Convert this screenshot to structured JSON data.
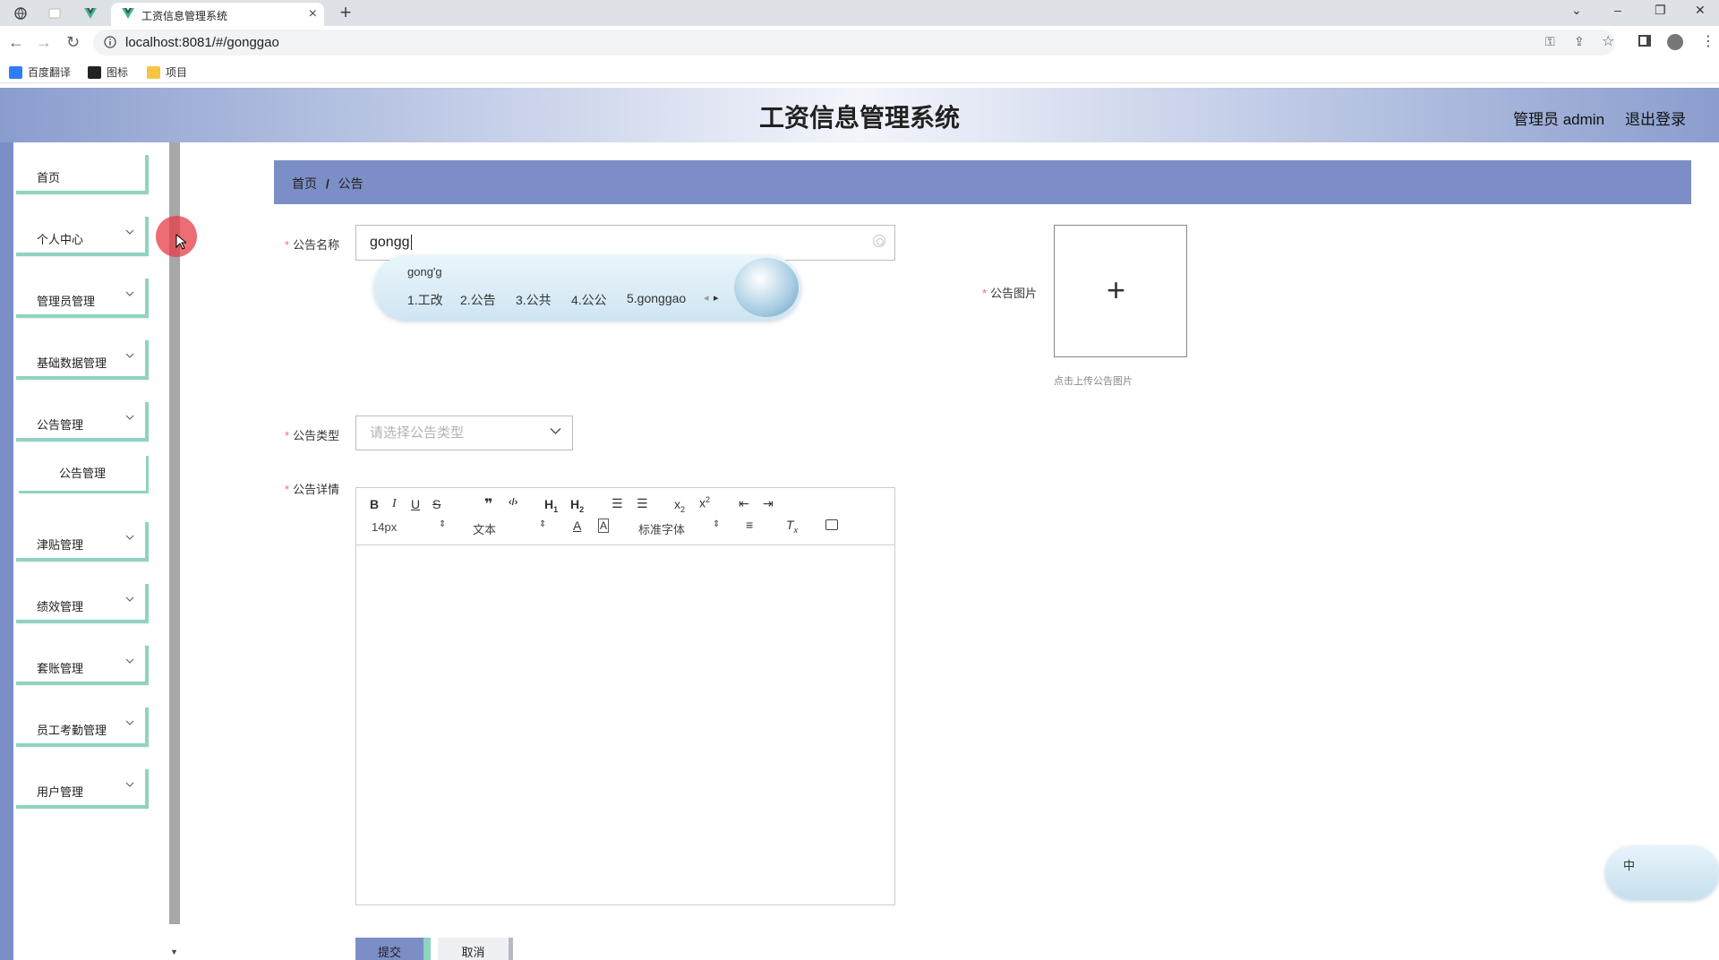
{
  "browser": {
    "tab_title": "工资信息管理系统",
    "url": "localhost:8081/#/gonggao",
    "bookmarks": [
      {
        "label": "百度翻译",
        "color": "#2f7cf6"
      },
      {
        "label": "图标",
        "color": "#222222"
      },
      {
        "label": "项目",
        "color": "#f5c542"
      }
    ]
  },
  "header": {
    "title": "工资信息管理系统",
    "admin": "管理员 admin",
    "logout": "退出登录"
  },
  "sidebar": {
    "items": [
      {
        "label": "首页"
      },
      {
        "label": "个人中心"
      },
      {
        "label": "管理员管理"
      },
      {
        "label": "基础数据管理"
      },
      {
        "label": "公告管理"
      },
      {
        "label": "公告管理"
      },
      {
        "label": "津贴管理"
      },
      {
        "label": "绩效管理"
      },
      {
        "label": "套账管理"
      },
      {
        "label": "员工考勤管理"
      },
      {
        "label": "用户管理"
      }
    ]
  },
  "breadcrumb": {
    "home": "首页",
    "sep": "/",
    "current": "公告"
  },
  "form": {
    "name_label": "公告名称",
    "name_value": "gongg",
    "type_label": "公告类型",
    "type_placeholder": "请选择公告类型",
    "detail_label": "公告详情",
    "image_label": "公告图片",
    "upload_tip": "点击上传公告图片",
    "submit": "提交",
    "cancel": "取消"
  },
  "editor": {
    "font_size": "14px",
    "block_type": "文本",
    "font_family": "标准字体"
  },
  "ime": {
    "input": "gong'g",
    "candidates": [
      "1.工改",
      "2.公告",
      "3.公共",
      "4.公公",
      "5.gonggao"
    ],
    "float_label": "中"
  },
  "colors": {
    "accent": "#7b8fc6",
    "mint": "#8fd3c1",
    "required": "#f56c6c"
  }
}
